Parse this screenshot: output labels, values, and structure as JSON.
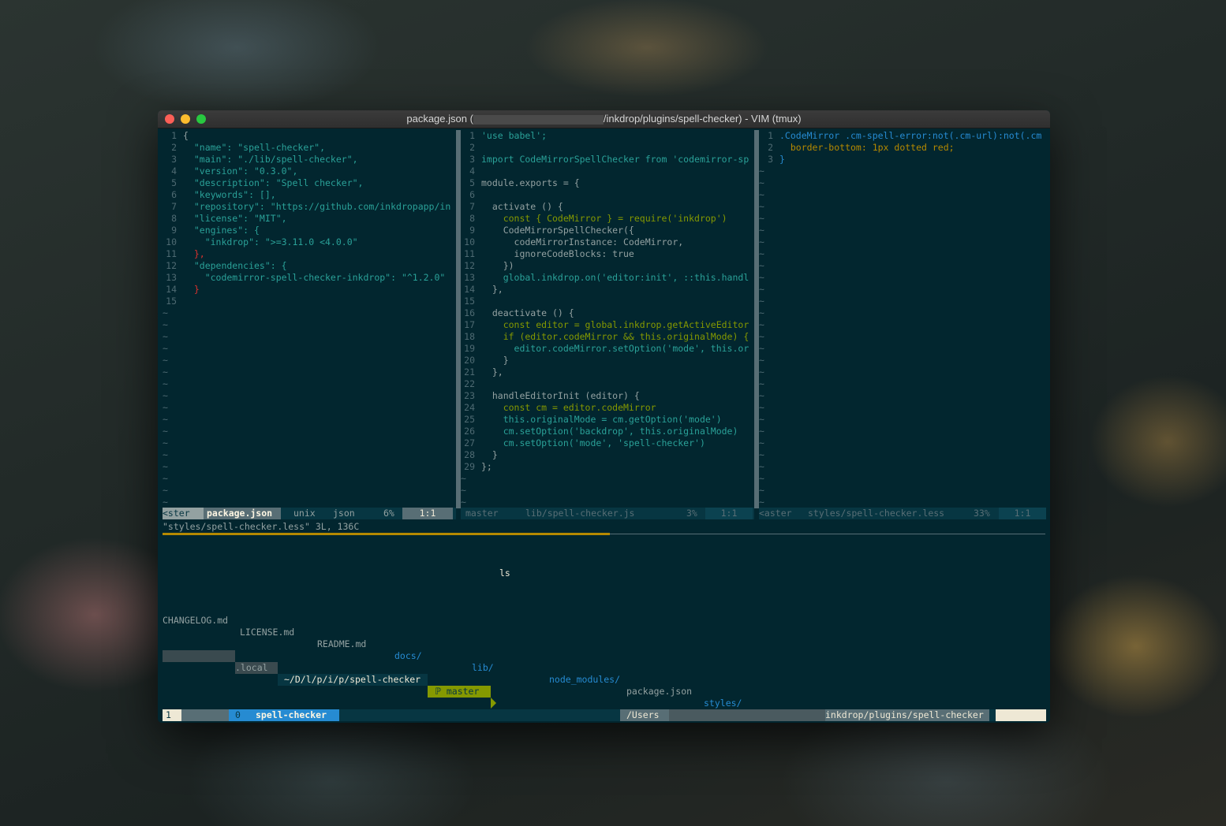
{
  "window": {
    "title_prefix": "package.json (",
    "title_suffix": "/inkdrop/plugins/spell-checker) - VIM (tmux)"
  },
  "pane1": {
    "lines": [
      {
        "n": "1",
        "t": "{"
      },
      {
        "n": "2",
        "t": "  \"name\": \"spell-checker\","
      },
      {
        "n": "3",
        "t": "  \"main\": \"./lib/spell-checker\","
      },
      {
        "n": "4",
        "t": "  \"version\": \"0.3.0\","
      },
      {
        "n": "5",
        "t": "  \"description\": \"Spell checker\","
      },
      {
        "n": "6",
        "t": "  \"keywords\": [],"
      },
      {
        "n": "7",
        "t": "  \"repository\": \"https://github.com/inkdropapp/in"
      },
      {
        "n": "8",
        "t": "  \"license\": \"MIT\","
      },
      {
        "n": "9",
        "t": "  \"engines\": {"
      },
      {
        "n": "10",
        "t": "    \"inkdrop\": \">=3.11.0 <4.0.0\""
      },
      {
        "n": "11",
        "t": "  },"
      },
      {
        "n": "12",
        "t": "  \"dependencies\": {"
      },
      {
        "n": "13",
        "t": "    \"codemirror-spell-checker-inkdrop\": \"^1.2.0\""
      },
      {
        "n": "14",
        "t": "  }"
      },
      {
        "n": "15",
        "t": ""
      }
    ],
    "status": {
      "branch": "<ster",
      "file": "package.json",
      "format": "unix",
      "type": "json",
      "percent": "6%",
      "pos": "1:1"
    }
  },
  "pane2": {
    "lines": [
      {
        "n": "1",
        "t": "'use babel';"
      },
      {
        "n": "2",
        "t": ""
      },
      {
        "n": "3",
        "t": "import CodeMirrorSpellChecker from 'codemirror-sp"
      },
      {
        "n": "4",
        "t": ""
      },
      {
        "n": "5",
        "t": "module.exports = {"
      },
      {
        "n": "6",
        "t": ""
      },
      {
        "n": "7",
        "t": "  activate () {"
      },
      {
        "n": "8",
        "t": "    const { CodeMirror } = require('inkdrop')"
      },
      {
        "n": "9",
        "t": "    CodeMirrorSpellChecker({"
      },
      {
        "n": "10",
        "t": "      codeMirrorInstance: CodeMirror,"
      },
      {
        "n": "11",
        "t": "      ignoreCodeBlocks: true"
      },
      {
        "n": "12",
        "t": "    })"
      },
      {
        "n": "13",
        "t": "    global.inkdrop.on('editor:init', ::this.handl"
      },
      {
        "n": "14",
        "t": "  },"
      },
      {
        "n": "15",
        "t": ""
      },
      {
        "n": "16",
        "t": "  deactivate () {"
      },
      {
        "n": "17",
        "t": "    const editor = global.inkdrop.getActiveEditor"
      },
      {
        "n": "18",
        "t": "    if (editor.codeMirror && this.originalMode) {"
      },
      {
        "n": "19",
        "t": "      editor.codeMirror.setOption('mode', this.or"
      },
      {
        "n": "20",
        "t": "    }"
      },
      {
        "n": "21",
        "t": "  },"
      },
      {
        "n": "22",
        "t": ""
      },
      {
        "n": "23",
        "t": "  handleEditorInit (editor) {"
      },
      {
        "n": "24",
        "t": "    const cm = editor.codeMirror"
      },
      {
        "n": "25",
        "t": "    this.originalMode = cm.getOption('mode')"
      },
      {
        "n": "26",
        "t": "    cm.setOption('backdrop', this.originalMode)"
      },
      {
        "n": "27",
        "t": "    cm.setOption('mode', 'spell-checker')"
      },
      {
        "n": "28",
        "t": "  }"
      },
      {
        "n": "29",
        "t": "};"
      }
    ],
    "status": {
      "branch": "master",
      "file": "lib/spell-checker.js",
      "percent": "3%",
      "pos": "1:1"
    }
  },
  "pane3": {
    "lines": [
      {
        "n": "1",
        "t": ".CodeMirror .cm-spell-error:not(.cm-url):not(.cm"
      },
      {
        "n": "2",
        "t": "  border-bottom: 1px dotted red;"
      },
      {
        "n": "3",
        "t": "}"
      }
    ],
    "status": {
      "branch": "<aster",
      "file": "styles/spell-checker.less",
      "percent": "33%",
      "pos": "1:1"
    }
  },
  "cmdline": "\"styles/spell-checker.less\" 3L, 136C",
  "terminal": {
    "command": "ls",
    "files": [
      "CHANGELOG.md",
      "LICENSE.md",
      "README.md",
      "docs/",
      "lib/",
      "node_modules/",
      "package.json",
      "styles/"
    ],
    "prompt_host": ".local",
    "prompt_path": "~/D/l/p/i/p/spell-checker",
    "prompt_branch": "master"
  },
  "tmux": {
    "session": "1",
    "window_index": "0",
    "window_name": "spell-checker",
    "path_prefix": "/Users",
    "path_suffix": "inkdrop/plugins/spell-checker"
  },
  "colors": {
    "background": "#02262f",
    "accent_yellow": "#b58900",
    "accent_blue": "#268bd2",
    "accent_green": "#859900",
    "accent_red": "#dc322f",
    "accent_cyan": "#2aa198"
  }
}
